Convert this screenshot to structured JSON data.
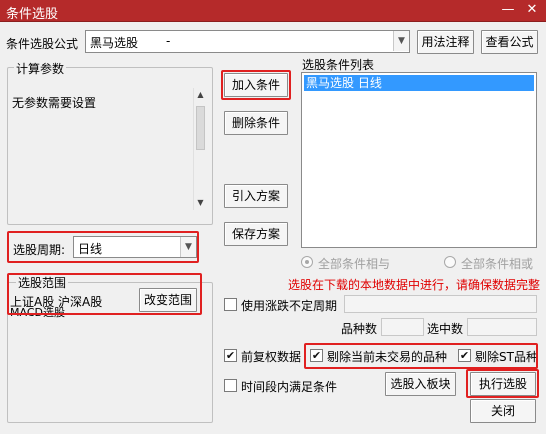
{
  "window": {
    "title": "条件选股",
    "minimize_glyph": "—",
    "close_glyph": "✕"
  },
  "formula": {
    "label": "条件选股公式",
    "value": "黑马选股",
    "value_suffix": "-",
    "btn_usage": "用法注释",
    "btn_view": "查看公式"
  },
  "params": {
    "group_label": "计算参数",
    "text": "无参数需要设置"
  },
  "period": {
    "label": "选股周期:",
    "value": "日线"
  },
  "range": {
    "group_label": "选股范围",
    "text_line1": "上证A股 沪深A股",
    "text_line2": "MACD选股",
    "btn_change": "改变范围"
  },
  "actions": {
    "add_condition": "加入条件",
    "delete_condition": "删除条件",
    "import_scheme": "引入方案",
    "save_scheme": "保存方案"
  },
  "condition_list": {
    "label": "选股条件列表",
    "items": [
      "黑马选股  日线"
    ]
  },
  "logic": {
    "all_and": "全部条件相与",
    "all_or": "全部条件相或"
  },
  "warning": {
    "text": "选股在下载的本地数据中进行，请确保数据完整",
    "color": "#e00000"
  },
  "options": {
    "uncertain_period": "使用涨跌不定周期",
    "count_label": "品种数",
    "selected_label": "选中数",
    "fq_data": "前复权数据",
    "exclude_untraded": "剔除当前未交易的品种",
    "exclude_st": "剔除ST品种",
    "period_satisfy": "时间段内满足条件"
  },
  "bottom": {
    "btn_to_block": "选股入板块",
    "btn_execute": "执行选股",
    "btn_close": "关闭"
  },
  "colors": {
    "titlebar": "#b52a2a",
    "highlight": "#e02020",
    "selection": "#3399ff"
  }
}
